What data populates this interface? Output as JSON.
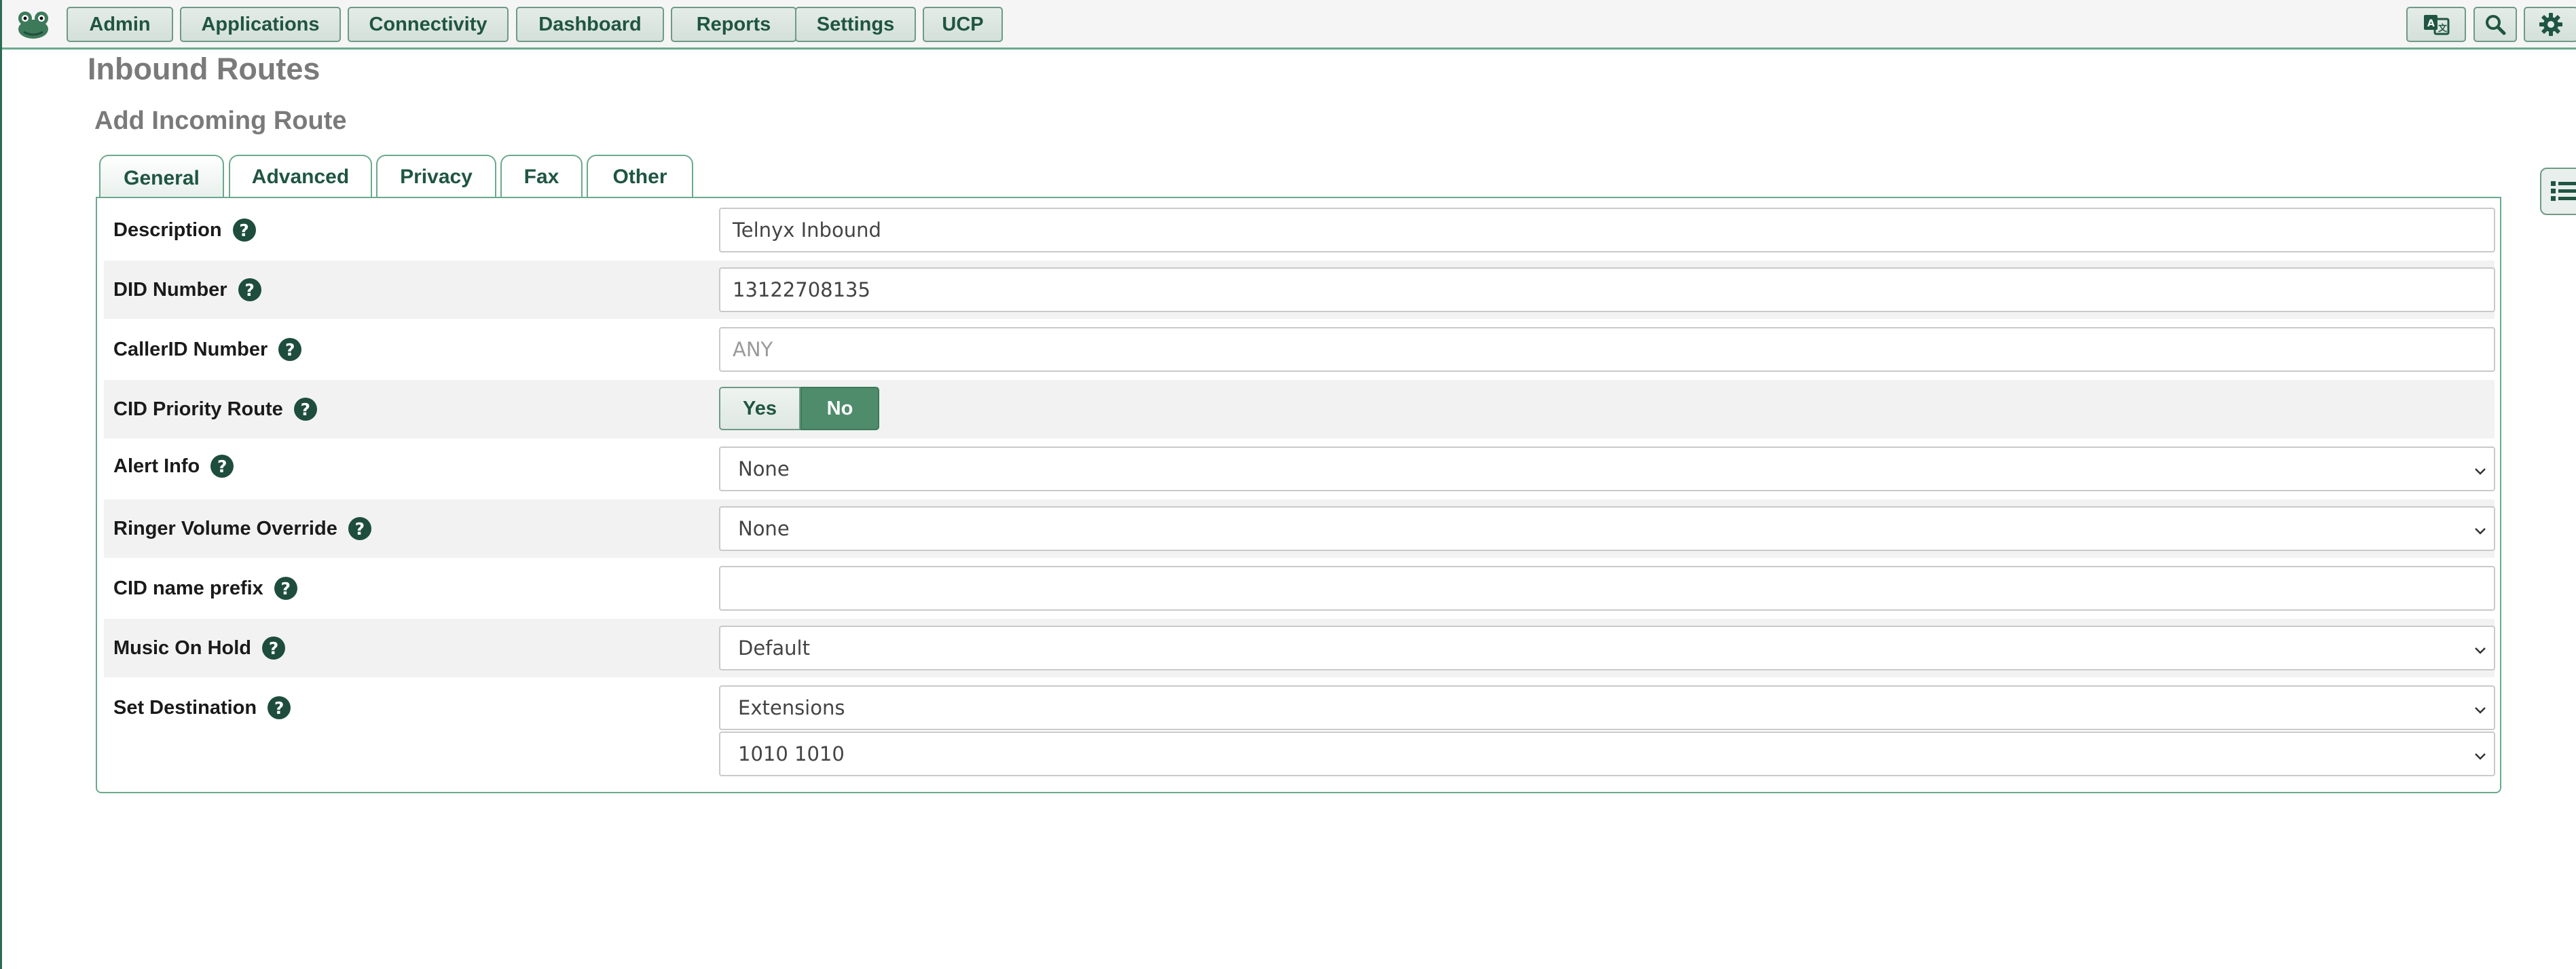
{
  "nav": {
    "items": [
      "Admin",
      "Applications",
      "Connectivity",
      "Dashboard",
      "Reports",
      "Settings",
      "UCP"
    ]
  },
  "page_title": "Inbound Routes",
  "section_title": "Add Incoming Route",
  "tabs": [
    {
      "label": "General",
      "active": true
    },
    {
      "label": "Advanced",
      "active": false
    },
    {
      "label": "Privacy",
      "active": false
    },
    {
      "label": "Fax",
      "active": false
    },
    {
      "label": "Other",
      "active": false
    }
  ],
  "form": {
    "description": {
      "label": "Description",
      "value": "Telnyx Inbound"
    },
    "did_number": {
      "label": "DID Number",
      "value": "13122708135"
    },
    "callerid_number": {
      "label": "CallerID Number",
      "placeholder": "ANY"
    },
    "cid_priority_route": {
      "label": "CID Priority Route",
      "yes_label": "Yes",
      "no_label": "No",
      "selected": "No"
    },
    "alert_info": {
      "label": "Alert Info",
      "value": "None"
    },
    "ringer_volume_override": {
      "label": "Ringer Volume Override",
      "value": "None"
    },
    "cid_name_prefix": {
      "label": "CID name prefix",
      "value": ""
    },
    "music_on_hold": {
      "label": "Music On Hold",
      "value": "Default"
    },
    "set_destination": {
      "label": "Set Destination",
      "type_value": "Extensions",
      "target_value": "1010 1010"
    }
  },
  "help_glyph": "?",
  "colors": {
    "accent": "#4e8c6c",
    "nav_text": "#1f5542",
    "border": "#6aa98c"
  }
}
